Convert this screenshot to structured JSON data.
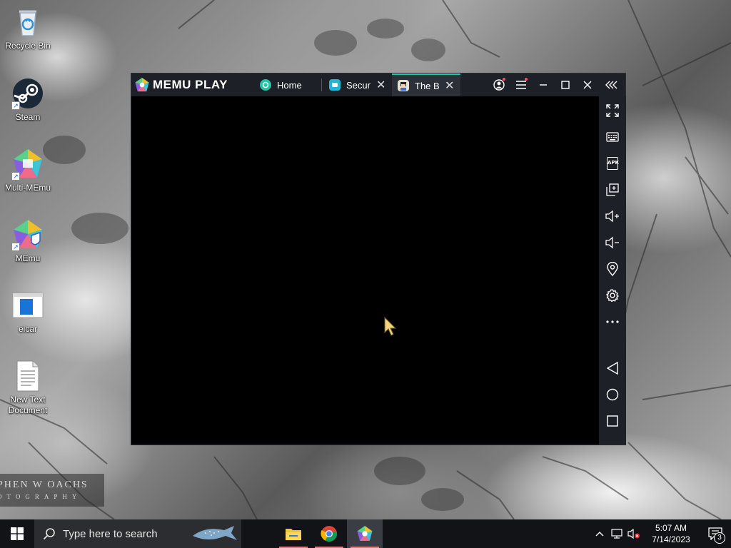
{
  "desktop": {
    "icons": [
      {
        "label": "Recycle Bin",
        "icon": "recycle-bin-icon"
      },
      {
        "label": "Steam",
        "icon": "steam-icon"
      },
      {
        "label": "Multi-MEmu",
        "icon": "multi-memu-icon"
      },
      {
        "label": "MEmu",
        "icon": "memu-icon"
      },
      {
        "label": "eicar",
        "icon": "eicar-file-icon"
      },
      {
        "label": "New Text Document",
        "icon": "text-document-icon"
      }
    ],
    "watermark": {
      "line1": "PHEN W OACHS",
      "line2": "OTOGRAPHY"
    }
  },
  "memu": {
    "logo_text": "MEMU PLAY",
    "accent": "#23c4a8",
    "tabs": [
      {
        "label": "Home",
        "icon": "home-tab-icon"
      },
      {
        "label": "Secur",
        "icon": "security-app-icon"
      },
      {
        "label": "The B",
        "icon": "game-avatar-icon",
        "active": true
      }
    ],
    "titlebar_buttons": [
      "account-icon",
      "menu-icon",
      "minimize-icon",
      "maximize-icon",
      "close-icon",
      "collapse-sidebar-icon"
    ],
    "sidebar_buttons": [
      "fullscreen-icon",
      "keyboard-icon",
      "apk-icon",
      "multi-window-icon",
      "volume-up-icon",
      "volume-down-icon",
      "location-icon",
      "settings-icon",
      "more-icon",
      "back-icon",
      "home-icon",
      "recents-icon"
    ],
    "apk_label": "APK"
  },
  "taskbar": {
    "search_placeholder": "Type here to search",
    "apps": [
      "file-explorer-icon",
      "chrome-icon",
      "memu-taskbar-icon"
    ],
    "time": "5:07 AM",
    "date": "7/14/2023",
    "notification_count": "3"
  }
}
